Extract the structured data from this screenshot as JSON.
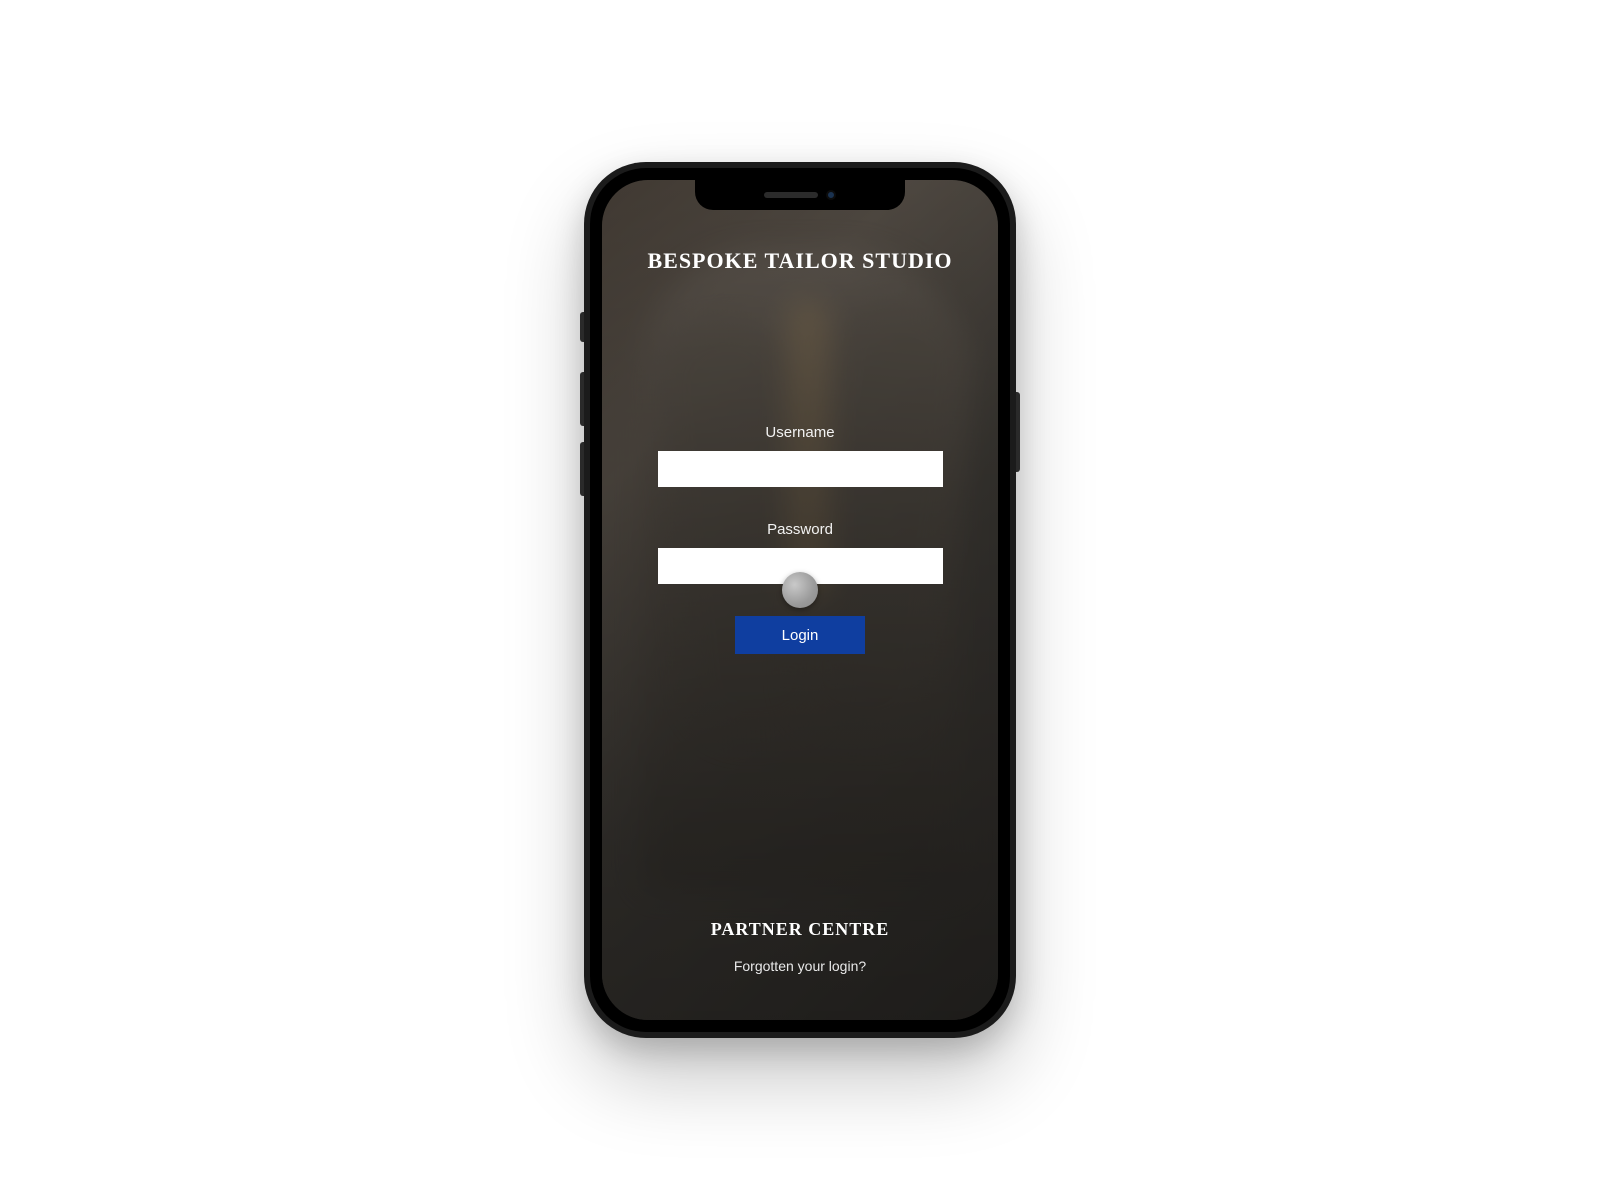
{
  "app": {
    "title": "BESPOKE TAILOR STUDIO"
  },
  "form": {
    "username_label": "Username",
    "username_value": "",
    "password_label": "Password",
    "password_value": "",
    "login_label": "Login"
  },
  "footer": {
    "title": "PARTNER CENTRE",
    "forgot_label": "Forgotten your login?"
  },
  "colors": {
    "primary": "#0f3ea0"
  }
}
